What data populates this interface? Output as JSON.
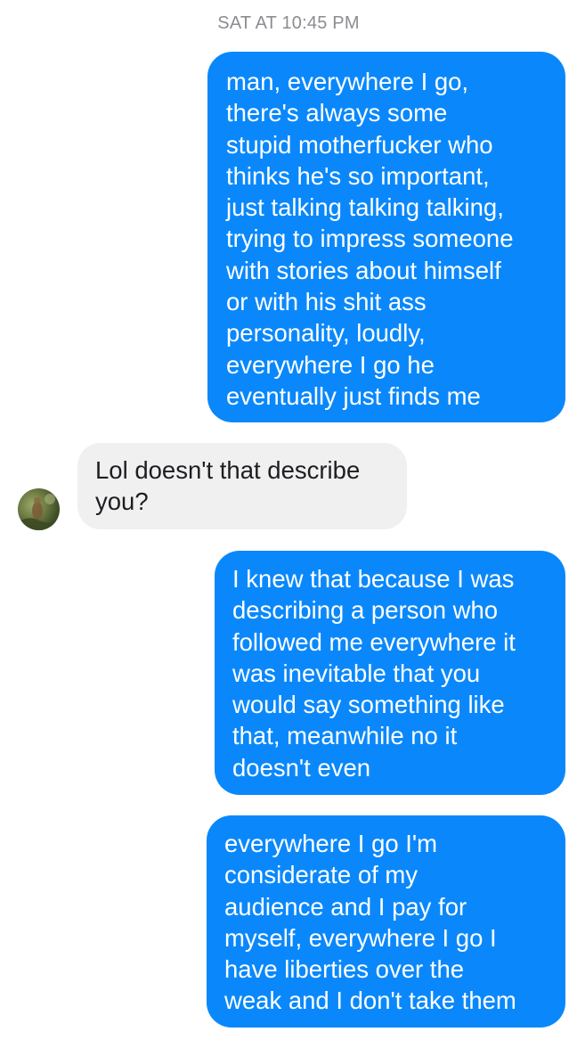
{
  "timestamp": "SAT AT 10:45 PM",
  "messages": [
    {
      "direction": "outgoing",
      "text": "man, everywhere I go,\nthere's always some\nstupid motherfucker who\nthinks he's so important,\njust talking talking talking,\ntrying to impress someone\nwith stories about himself\nor with his shit ass\npersonality, loudly,\neverywhere I go he\neventually just finds me"
    },
    {
      "direction": "incoming",
      "text": "Lol doesn't that describe\nyou?"
    },
    {
      "direction": "outgoing",
      "text": "I knew that because I was\ndescribing a person who\nfollowed me everywhere it\nwas inevitable that you\nwould say something like\nthat, meanwhile no it\ndoesn't even"
    },
    {
      "direction": "outgoing",
      "text": "everywhere I go I'm\nconsiderate of my\naudience and I pay for\nmyself, everywhere I go I\nhave liberties over the\nweak and I don't take them"
    }
  ],
  "colors": {
    "outgoing_bubble": "#0a88fb",
    "incoming_bubble": "#f0f0f0",
    "timestamp_text": "#8b8d91"
  },
  "avatar": {
    "icon": "contact-avatar-photo"
  }
}
